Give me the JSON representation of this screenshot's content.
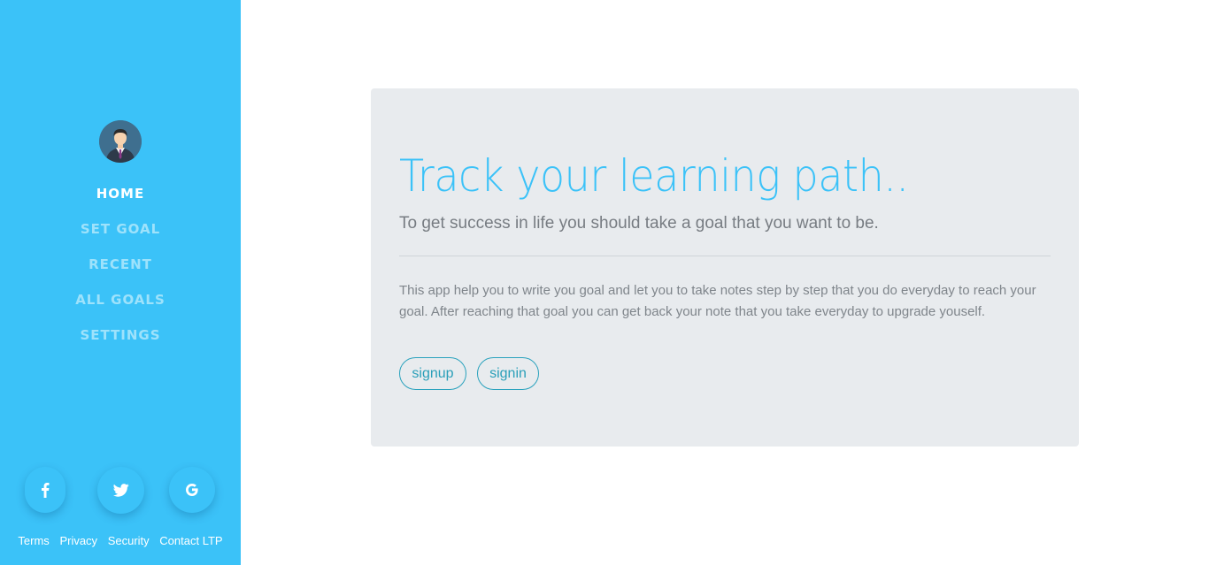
{
  "sidebar": {
    "nav": [
      {
        "label": "HOME",
        "active": true
      },
      {
        "label": "SET GOAL",
        "active": false
      },
      {
        "label": "RECENT",
        "active": false
      },
      {
        "label": "ALL GOALS",
        "active": false
      },
      {
        "label": "SETTINGS",
        "active": false
      }
    ],
    "social": [
      {
        "icon": "facebook-icon",
        "glyph": "f"
      },
      {
        "icon": "twitter-icon",
        "glyph": "bird"
      },
      {
        "icon": "google-icon",
        "glyph": "G"
      }
    ],
    "footer_links": [
      "Terms",
      "Privacy",
      "Security",
      "Contact LTP"
    ]
  },
  "card": {
    "title": "Track your learning path..",
    "lead": "To get success in life you should take a goal that you want to be.",
    "description": "This app help you to write you goal and let you to take notes step by step that you do everyday to reach your goal. After reaching that goal you can get back your note that you take everyday to upgrade youself.",
    "buttons": {
      "signup": "signup",
      "signin": "signin"
    }
  },
  "colors": {
    "sidebar_bg": "#3bc2f8",
    "nav_inactive": "#9ee2fb",
    "card_bg": "#e8ebee",
    "title": "#3bc2f8",
    "button_border": "#2aa2bd"
  }
}
